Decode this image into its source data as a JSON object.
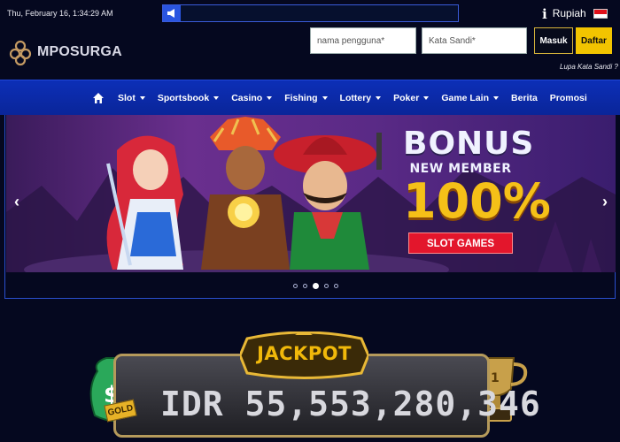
{
  "topbar": {
    "datetime": "Thu, February 16, 1:34:29 AM",
    "currency": "Rupiah",
    "info_icon": "info-icon",
    "speaker_icon": "megaphone-icon"
  },
  "header": {
    "brand": "MPOSURGA",
    "username_placeholder": "nama pengguna*",
    "password_placeholder": "Kata Sandi*",
    "login_label": "Masuk",
    "register_label": "Daftar",
    "forgot_label": "Lupa Kata Sandi ?"
  },
  "nav": {
    "home_icon": "home-icon",
    "items": [
      {
        "label": "Slot",
        "dropdown": true
      },
      {
        "label": "Sportsbook",
        "dropdown": true
      },
      {
        "label": "Casino",
        "dropdown": true
      },
      {
        "label": "Fishing",
        "dropdown": true
      },
      {
        "label": "Lottery",
        "dropdown": true
      },
      {
        "label": "Poker",
        "dropdown": true
      },
      {
        "label": "Game Lain",
        "dropdown": true
      },
      {
        "label": "Berita",
        "dropdown": false
      },
      {
        "label": "Promosi",
        "dropdown": false
      }
    ]
  },
  "banner": {
    "line1": "BONUS",
    "line2": "NEW MEMBER",
    "line3": "100%",
    "cta": "SLOT GAMES",
    "prev": "‹",
    "next": "›",
    "slide_count": 5,
    "active_slide": 3
  },
  "jackpot": {
    "title": "JACKPOT",
    "amount": "IDR 55,553,280,346",
    "tag": "GOLD"
  },
  "colors": {
    "background": "#05081f",
    "nav": "#0c2fb7",
    "accent": "#f2c400",
    "cta": "#e3162c"
  }
}
